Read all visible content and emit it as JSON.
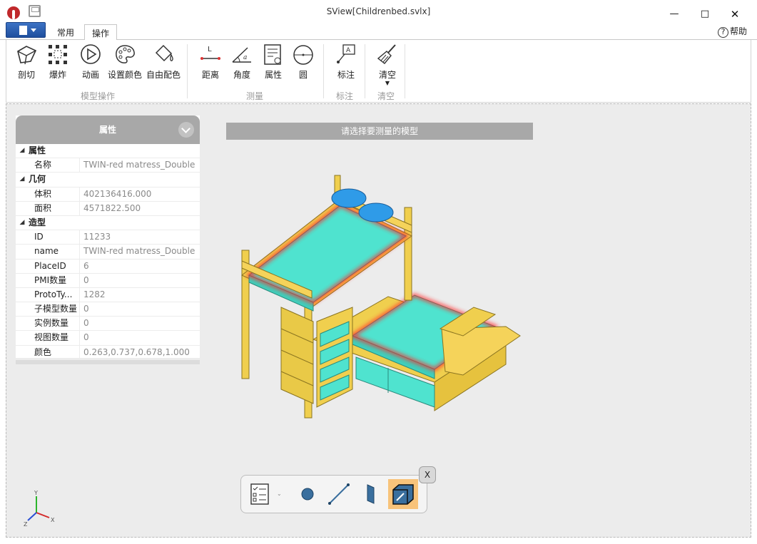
{
  "window": {
    "title": "SView[Childrenbed.svlx]"
  },
  "tabs": {
    "common": "常用",
    "ops": "操作"
  },
  "help_label": "帮助",
  "ribbon": {
    "groups": [
      {
        "label": "模型操作",
        "buttons": [
          "剖切",
          "爆炸",
          "动画",
          "设置颜色",
          "自由配色"
        ]
      },
      {
        "label": "测量",
        "buttons": [
          "距离",
          "角度",
          "属性",
          "圆"
        ]
      },
      {
        "label": "标注",
        "buttons": [
          "标注"
        ]
      },
      {
        "label": "清空",
        "buttons": [
          "清空"
        ]
      }
    ]
  },
  "properties": {
    "title": "属性",
    "sections": [
      {
        "name": "属性",
        "rows": [
          {
            "key": "名称",
            "value": "TWIN-red matress_Double"
          }
        ]
      },
      {
        "name": "几何",
        "rows": [
          {
            "key": "体积",
            "value": "402136416.000"
          },
          {
            "key": "面积",
            "value": "4571822.500"
          }
        ]
      },
      {
        "name": "造型",
        "rows": [
          {
            "key": "ID",
            "value": "11233"
          },
          {
            "key": "name",
            "value": "TWIN-red matress_Double"
          },
          {
            "key": "PlaceID",
            "value": "6"
          },
          {
            "key": "PMI数量",
            "value": "0"
          },
          {
            "key": "ProtoTy...",
            "value": "1282"
          },
          {
            "key": "子模型数量",
            "value": "0"
          },
          {
            "key": "实例数量",
            "value": "0"
          },
          {
            "key": "视图数量",
            "value": "0"
          },
          {
            "key": "颜色",
            "value": "0.263,0.737,0.678,1.000"
          }
        ]
      }
    ]
  },
  "prompt": "请选择要测量的模型",
  "measure_toolbar": {
    "close_label": "X",
    "selected_tool": "solid"
  },
  "axis": {
    "x": "X",
    "y": "Y",
    "z": "Z"
  },
  "colors": {
    "accent": "#2a5caa",
    "mattress": "#4fe3cf",
    "frame": "#f2d04a",
    "highlight": "#ff2a2a",
    "pillow": "#2f9be8"
  }
}
